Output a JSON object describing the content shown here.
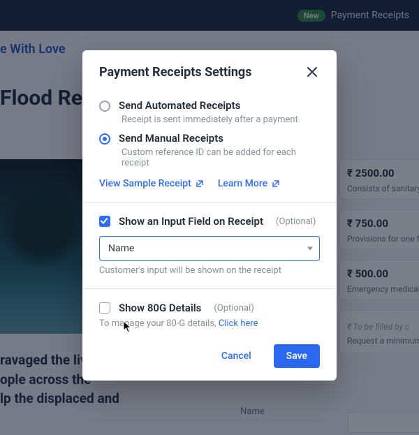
{
  "header": {
    "badge": "New",
    "menu_item": "Payment Receipts"
  },
  "background": {
    "brand_fragment": "e With Love",
    "page_title_fragment": "Flood Relief",
    "story_l1": " ravaged the liv",
    "story_l2": "ople across the",
    "story_l3": "lp the displaced and",
    "tiers": [
      {
        "price": "₹ 2500.00",
        "desc": "Consists of sanitary n kits, bucket & mug"
      },
      {
        "price": "₹ 750.00",
        "desc": "Provisions for one fam salt, sugar, oil, spices"
      },
      {
        "price": "₹ 500.00",
        "desc": "Emergency medical s"
      }
    ],
    "custom_tier_placeholder": "₹ To be filled by c",
    "custom_tier_help": "Request a minimum a",
    "custom_label": "Name"
  },
  "modal": {
    "title": "Payment Receipts Settings",
    "receipt_mode": {
      "auto": {
        "label": "Send Automated Receipts",
        "sub": "Receipt is sent immediately after a payment"
      },
      "manual": {
        "label": "Send Manual Receipts",
        "sub": "Custom reference ID can be added for each receipt"
      }
    },
    "links": {
      "sample": "View Sample Receipt",
      "learn": "Learn More"
    },
    "input_field": {
      "label": "Show an Input Field on Receipt",
      "optional": "(Optional)",
      "select_value": "Name",
      "help": "Customer's input will be shown on the receipt"
    },
    "eighty_g": {
      "label": "Show 80G Details",
      "optional": "(Optional)",
      "help_prefix": "To manage your 80-G details, ",
      "help_link": "Click here"
    },
    "footer": {
      "cancel": "Cancel",
      "save": "Save"
    }
  }
}
